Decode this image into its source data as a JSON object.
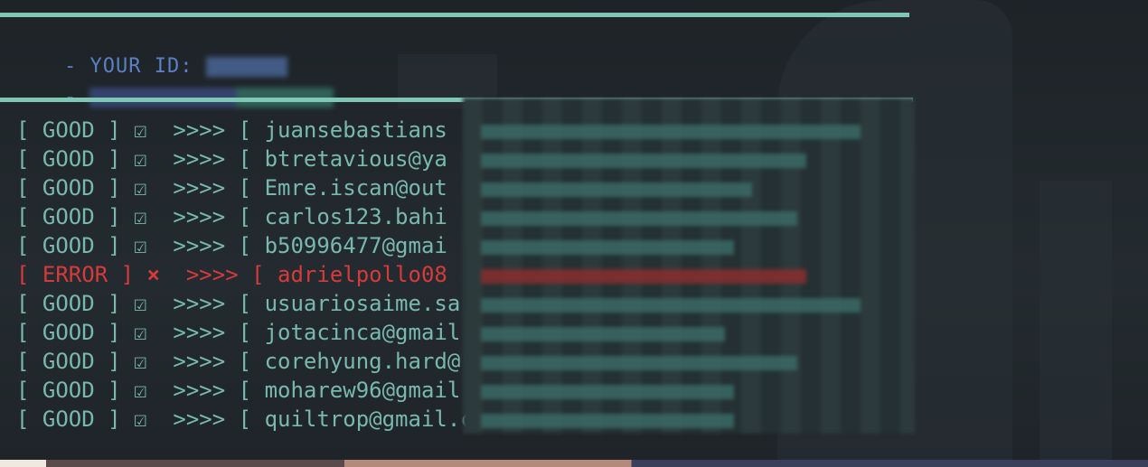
{
  "header": {
    "id_prefix": "- YOUR ID: ",
    "line2_prefix": "- "
  },
  "log": {
    "lines": [
      {
        "status": "[ GOOD ]",
        "mark": "☑",
        "arrow": ">>>> [",
        "text": "juansebastians"
      },
      {
        "status": "[ GOOD ]",
        "mark": "☑",
        "arrow": ">>>> [",
        "text": "btretavious@ya"
      },
      {
        "status": "[ GOOD ]",
        "mark": "☑",
        "arrow": ">>>> [",
        "text": "Emre.iscan@out"
      },
      {
        "status": "[ GOOD ]",
        "mark": "☑",
        "arrow": ">>>> [",
        "text": "carlos123.bahi"
      },
      {
        "status": "[ GOOD ]",
        "mark": "☑",
        "arrow": ">>>> [",
        "text": "b50996477@gmai"
      },
      {
        "status": "[ ERROR ]",
        "mark": "×",
        "arrow": ">>>> [",
        "text": "adrielpollo08"
      },
      {
        "status": "[ GOOD ]",
        "mark": "☑",
        "arrow": ">>>> [",
        "text": "usuariosaime.sa"
      },
      {
        "status": "[ GOOD ]",
        "mark": "☑",
        "arrow": ">>>> [",
        "text": "jotacinca@gmail"
      },
      {
        "status": "[ GOOD ]",
        "mark": "☑",
        "arrow": ">>>> [",
        "text": "corehyung.hard@"
      },
      {
        "status": "[ GOOD ]",
        "mark": "☑",
        "arrow": ">>>> [",
        "text": "moharew96@gmail"
      },
      {
        "status": "[ GOOD ]",
        "mark": "☑",
        "arrow": ">>>> [",
        "text": "quiltrop@gmail.co"
      }
    ]
  },
  "colors": {
    "accent_rule": "#7fc7b5",
    "good_text": "#79b8b0",
    "error_text": "#d63a3a",
    "header_text": "#5b7fc2"
  }
}
